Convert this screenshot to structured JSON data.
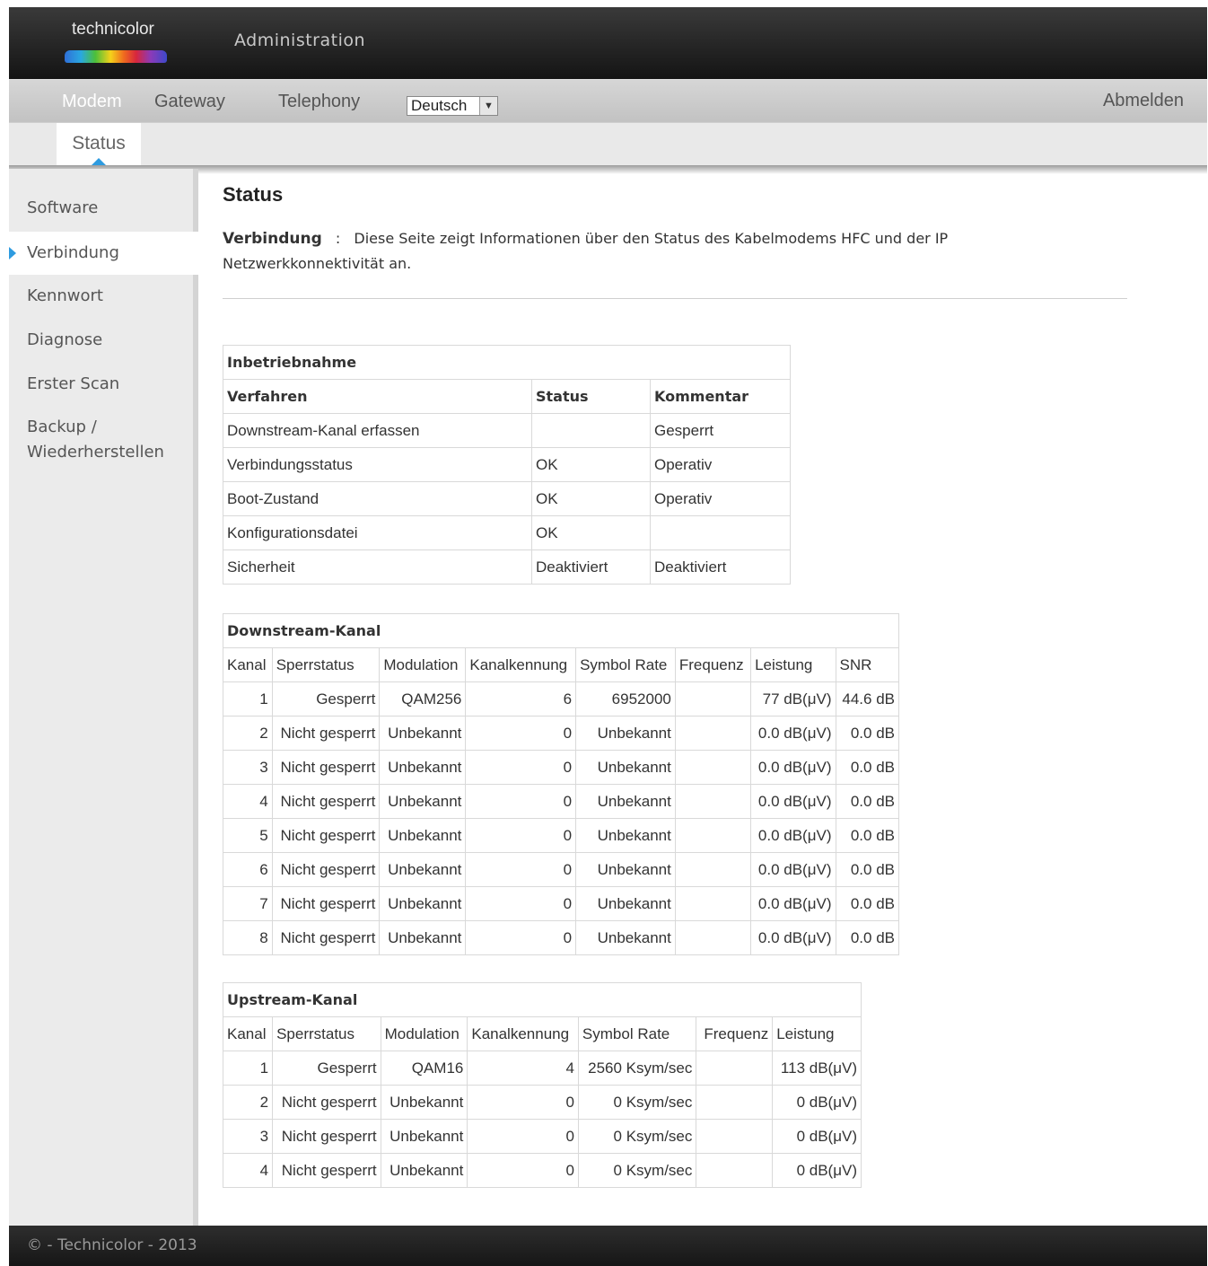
{
  "header": {
    "logo_text": "technicolor",
    "title": "Administration"
  },
  "nav": {
    "items": [
      {
        "label": "Modem",
        "active": true
      },
      {
        "label": "Gateway",
        "active": false
      },
      {
        "label": "Telephony",
        "active": false
      }
    ],
    "language": "Deutsch",
    "logout": "Abmelden"
  },
  "subnav": {
    "active_tab": "Status"
  },
  "sidebar": {
    "items": [
      {
        "label": "Software",
        "active": false
      },
      {
        "label": "Verbindung",
        "active": true
      },
      {
        "label": "Kennwort",
        "active": false
      },
      {
        "label": "Diagnose",
        "active": false
      },
      {
        "label": "Erster Scan",
        "active": false
      },
      {
        "label": "Backup / Wiederherstellen",
        "active": false
      }
    ]
  },
  "main": {
    "title": "Status",
    "desc_label": "Verbindung",
    "desc_sep": ":",
    "desc_text": "Diese Seite zeigt Informationen über den Status des Kabelmodems HFC und der IP Netzwerkkonnektivität an."
  },
  "startup": {
    "caption": "Inbetriebnahme",
    "headers": [
      "Verfahren",
      "Status",
      "Kommentar"
    ],
    "rows": [
      [
        "Downstream-Kanal erfassen",
        "",
        "Gesperrt"
      ],
      [
        "Verbindungsstatus",
        "OK",
        "Operativ"
      ],
      [
        "Boot-Zustand",
        "OK",
        "Operativ"
      ],
      [
        "Konfigurationsdatei",
        "OK",
        ""
      ],
      [
        "Sicherheit",
        "Deaktiviert",
        "Deaktiviert"
      ]
    ]
  },
  "downstream": {
    "caption": "Downstream-Kanal",
    "headers": [
      "Kanal",
      "Sperrstatus",
      "Modulation",
      "Kanalkennung",
      "Symbol Rate",
      "Frequenz",
      "Leistung",
      "SNR"
    ],
    "rows": [
      [
        "1",
        "Gesperrt",
        "QAM256",
        "6",
        "6952000",
        "",
        "77 dB(μV)",
        "44.6 dB"
      ],
      [
        "2",
        "Nicht gesperrt",
        "Unbekannt",
        "0",
        "Unbekannt",
        "",
        "0.0 dB(μV)",
        "0.0 dB"
      ],
      [
        "3",
        "Nicht gesperrt",
        "Unbekannt",
        "0",
        "Unbekannt",
        "",
        "0.0 dB(μV)",
        "0.0 dB"
      ],
      [
        "4",
        "Nicht gesperrt",
        "Unbekannt",
        "0",
        "Unbekannt",
        "",
        "0.0 dB(μV)",
        "0.0 dB"
      ],
      [
        "5",
        "Nicht gesperrt",
        "Unbekannt",
        "0",
        "Unbekannt",
        "",
        "0.0 dB(μV)",
        "0.0 dB"
      ],
      [
        "6",
        "Nicht gesperrt",
        "Unbekannt",
        "0",
        "Unbekannt",
        "",
        "0.0 dB(μV)",
        "0.0 dB"
      ],
      [
        "7",
        "Nicht gesperrt",
        "Unbekannt",
        "0",
        "Unbekannt",
        "",
        "0.0 dB(μV)",
        "0.0 dB"
      ],
      [
        "8",
        "Nicht gesperrt",
        "Unbekannt",
        "0",
        "Unbekannt",
        "",
        "0.0 dB(μV)",
        "0.0 dB"
      ]
    ]
  },
  "upstream": {
    "caption": "Upstream-Kanal",
    "headers": [
      "Kanal",
      "Sperrstatus",
      "Modulation",
      "Kanalkennung",
      "Symbol Rate",
      "Frequenz",
      "Leistung"
    ],
    "rows": [
      [
        "1",
        "Gesperrt",
        "QAM16",
        "4",
        "2560 Ksym/sec",
        "",
        "113 dB(μV)"
      ],
      [
        "2",
        "Nicht gesperrt",
        "Unbekannt",
        "0",
        "0 Ksym/sec",
        "",
        "0 dB(μV)"
      ],
      [
        "3",
        "Nicht gesperrt",
        "Unbekannt",
        "0",
        "0 Ksym/sec",
        "",
        "0 dB(μV)"
      ],
      [
        "4",
        "Nicht gesperrt",
        "Unbekannt",
        "0",
        "0 Ksym/sec",
        "",
        "0 dB(μV)"
      ]
    ]
  },
  "footer": {
    "copyright": "© - Technicolor - 2013"
  }
}
